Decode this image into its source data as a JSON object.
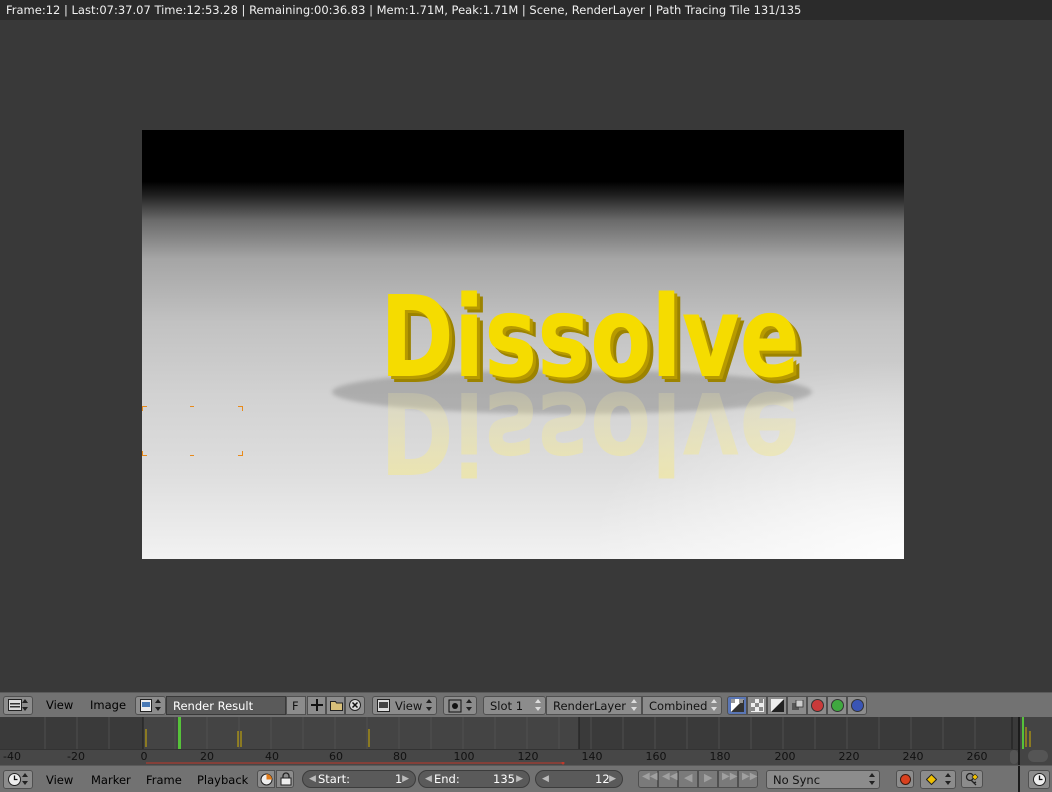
{
  "info_bar": {
    "text": "Frame:12 | Last:07:37.07 Time:12:53.28 | Remaining:00:36.83 | Mem:1.71M, Peak:1.71M | Scene, RenderLayer | Path Tracing Tile 131/135"
  },
  "render": {
    "word": "Dissolve",
    "colors": {
      "text": "#f5dc00",
      "text_shadow": "#b79a00",
      "reflection": "#efe6a0",
      "tile_marker": "#e88a1a"
    }
  },
  "image_header": {
    "editor_type_icon": "image-editor-icon",
    "menus": [
      "View",
      "Image"
    ],
    "image_browse_icon": "image-browse-icon",
    "image_name": "Render Result",
    "fake_user": "F",
    "new_icon": "plus-icon",
    "open_icon": "folder-icon",
    "unlink_icon": "x-icon",
    "view_mode": "View",
    "pivot_icon": "crosshair-icon",
    "slot": "Slot 1",
    "layer": "RenderLayer",
    "pass": "Combined",
    "channel_icons": [
      "rgb-alpha-icon",
      "alpha-checker-icon",
      "zbuffer-icon",
      "composite-icon",
      "red-channel-icon",
      "green-channel-icon",
      "blue-channel-icon"
    ]
  },
  "timeline": {
    "ruler_labels": [
      "-40",
      "-20",
      "0",
      "20",
      "40",
      "60",
      "80",
      "100",
      "120",
      "140",
      "160",
      "180",
      "200",
      "220",
      "240",
      "260"
    ],
    "current_frame": 12
  },
  "timeline_header": {
    "editor_type_icon": "timeline-icon",
    "menus": [
      "View",
      "Marker",
      "Frame",
      "Playback"
    ],
    "start_label": "Start:",
    "start_value": "1",
    "end_label": "End:",
    "end_value": "135",
    "current_frame": "12",
    "sync": "No Sync",
    "playback_icons": [
      "jump-start-icon",
      "jump-keyframe-back-icon",
      "play-reverse-icon",
      "play-icon",
      "jump-keyframe-forward-icon",
      "jump-end-icon"
    ],
    "record_icon": "record-icon",
    "keyframe_icon": "keyframe-icon",
    "keying_icon": "keying-set-icon"
  }
}
